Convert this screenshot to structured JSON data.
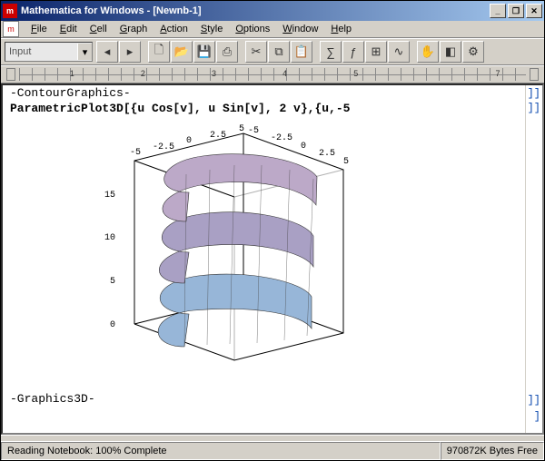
{
  "titlebar": {
    "title": "Mathematica for Windows - [Newnb-1]"
  },
  "menus": {
    "file": "File",
    "edit": "Edit",
    "cell": "Cell",
    "graph": "Graph",
    "action": "Action",
    "style": "Style",
    "options": "Options",
    "window": "Window",
    "help": "Help"
  },
  "styleselector": {
    "value": "Input"
  },
  "notebook": {
    "line1": "-ContourGraphics-",
    "code": "ParametricPlot3D[{u Cos[v], u Sin[v], 2 v},{u,-5",
    "line3": "-Graphics3D-"
  },
  "chart_data": {
    "type": "surface3d",
    "function": "ParametricPlot3D",
    "params": {
      "fx": "u*Cos[v]",
      "fy": "u*Sin[v]",
      "fz": "2*v"
    },
    "u_range": [
      -5,
      5
    ],
    "x_ticks": [
      -5,
      -2.5,
      0,
      2.5,
      5
    ],
    "y_ticks": [
      -5,
      -2.5,
      0,
      2.5,
      5
    ],
    "z_ticks": [
      0,
      5,
      10,
      15
    ],
    "box": {
      "x": [
        -5,
        5
      ],
      "y": [
        -5,
        5
      ],
      "z": [
        0,
        15
      ]
    }
  },
  "ruler": {
    "n1": "1",
    "n2": "2",
    "n3": "3",
    "n4": "4",
    "n5": "5",
    "n7": "7"
  },
  "status": {
    "left": "Reading Notebook: 100% Complete",
    "right": "970872K Bytes Free"
  }
}
